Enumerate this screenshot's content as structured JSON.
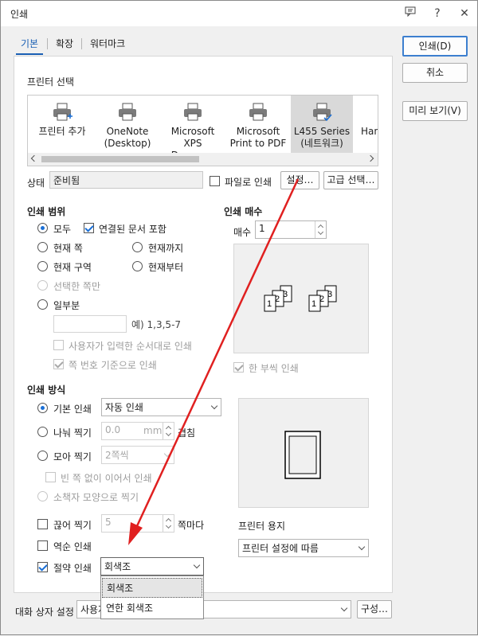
{
  "window": {
    "title": "인쇄"
  },
  "title_icons": {
    "chat": "chat-icon",
    "help": "?",
    "close": "✕"
  },
  "tabs": [
    "기본",
    "확장",
    "워터마크"
  ],
  "side_buttons": {
    "print": "인쇄(D)",
    "cancel": "취소",
    "preview": "미리 보기(V)"
  },
  "printer_select": {
    "heading": "프린터 선택",
    "printers": [
      {
        "line1": "프린터 추가",
        "line2": ""
      },
      {
        "line1": "OneNote",
        "line2": "(Desktop)"
      },
      {
        "line1": "Microsoft",
        "line2": "XPS Docum…"
      },
      {
        "line1": "Microsoft",
        "line2": "Print to PDF"
      },
      {
        "line1": "L455 Series",
        "line2": "(네트워크)"
      },
      {
        "line1": "Hand",
        "line2": ""
      }
    ],
    "selected_index": 4
  },
  "status": {
    "label": "상태",
    "value": "준비됨",
    "file_print": "파일로 인쇄",
    "settings": "설정…",
    "advanced": "고급 선택…"
  },
  "print_range": {
    "heading": "인쇄 범위",
    "all": "모두",
    "linked_docs": "연결된 문서 포함",
    "current_page": "현재 쪽",
    "up_to_current": "현재까지",
    "current_section": "현재 구역",
    "from_current": "현재부터",
    "selected_pages": "선택한 쪽만",
    "partial": "일부분",
    "partial_value": "",
    "example": "예) 1,3,5-7",
    "user_order": "사용자가 입력한 순서대로 인쇄",
    "page_number_based": "쪽 번호 기준으로 인쇄"
  },
  "copies": {
    "heading": "인쇄 매수",
    "label": "매수",
    "value": "1",
    "collate": "한 부씩 인쇄",
    "collate_checked": true
  },
  "print_method": {
    "heading": "인쇄 방식",
    "basic": "기본 인쇄",
    "basic_combo": "자동 인쇄",
    "split": "나눠 찍기",
    "split_value": "0.0",
    "split_unit": "mm",
    "split_suffix": "겹침",
    "gather": "모아 찍기",
    "gather_combo": "2쪽씩",
    "no_blank": "빈 쪽 없이 이어서 인쇄",
    "booklet": "소책자 모양으로 찍기",
    "cut_print": "끊어 찍기",
    "cut_value": "5",
    "cut_suffix": "쪽마다",
    "reverse": "역순 인쇄",
    "save_print": "절약 인쇄",
    "save_combo": "회색조",
    "save_checked": true
  },
  "printer_paper": {
    "heading": "프린터 용지",
    "combo": "프린터 설정에 따름"
  },
  "save_dropdown": {
    "options": [
      "회색조",
      "연한 회색조"
    ],
    "highlighted": 0
  },
  "dialog_settings": {
    "label": "대화 상자 설정",
    "combo": "사용자",
    "configure": "구성…"
  },
  "colors": {
    "accent": "#1a5fb4",
    "arrow": "#e02020"
  }
}
